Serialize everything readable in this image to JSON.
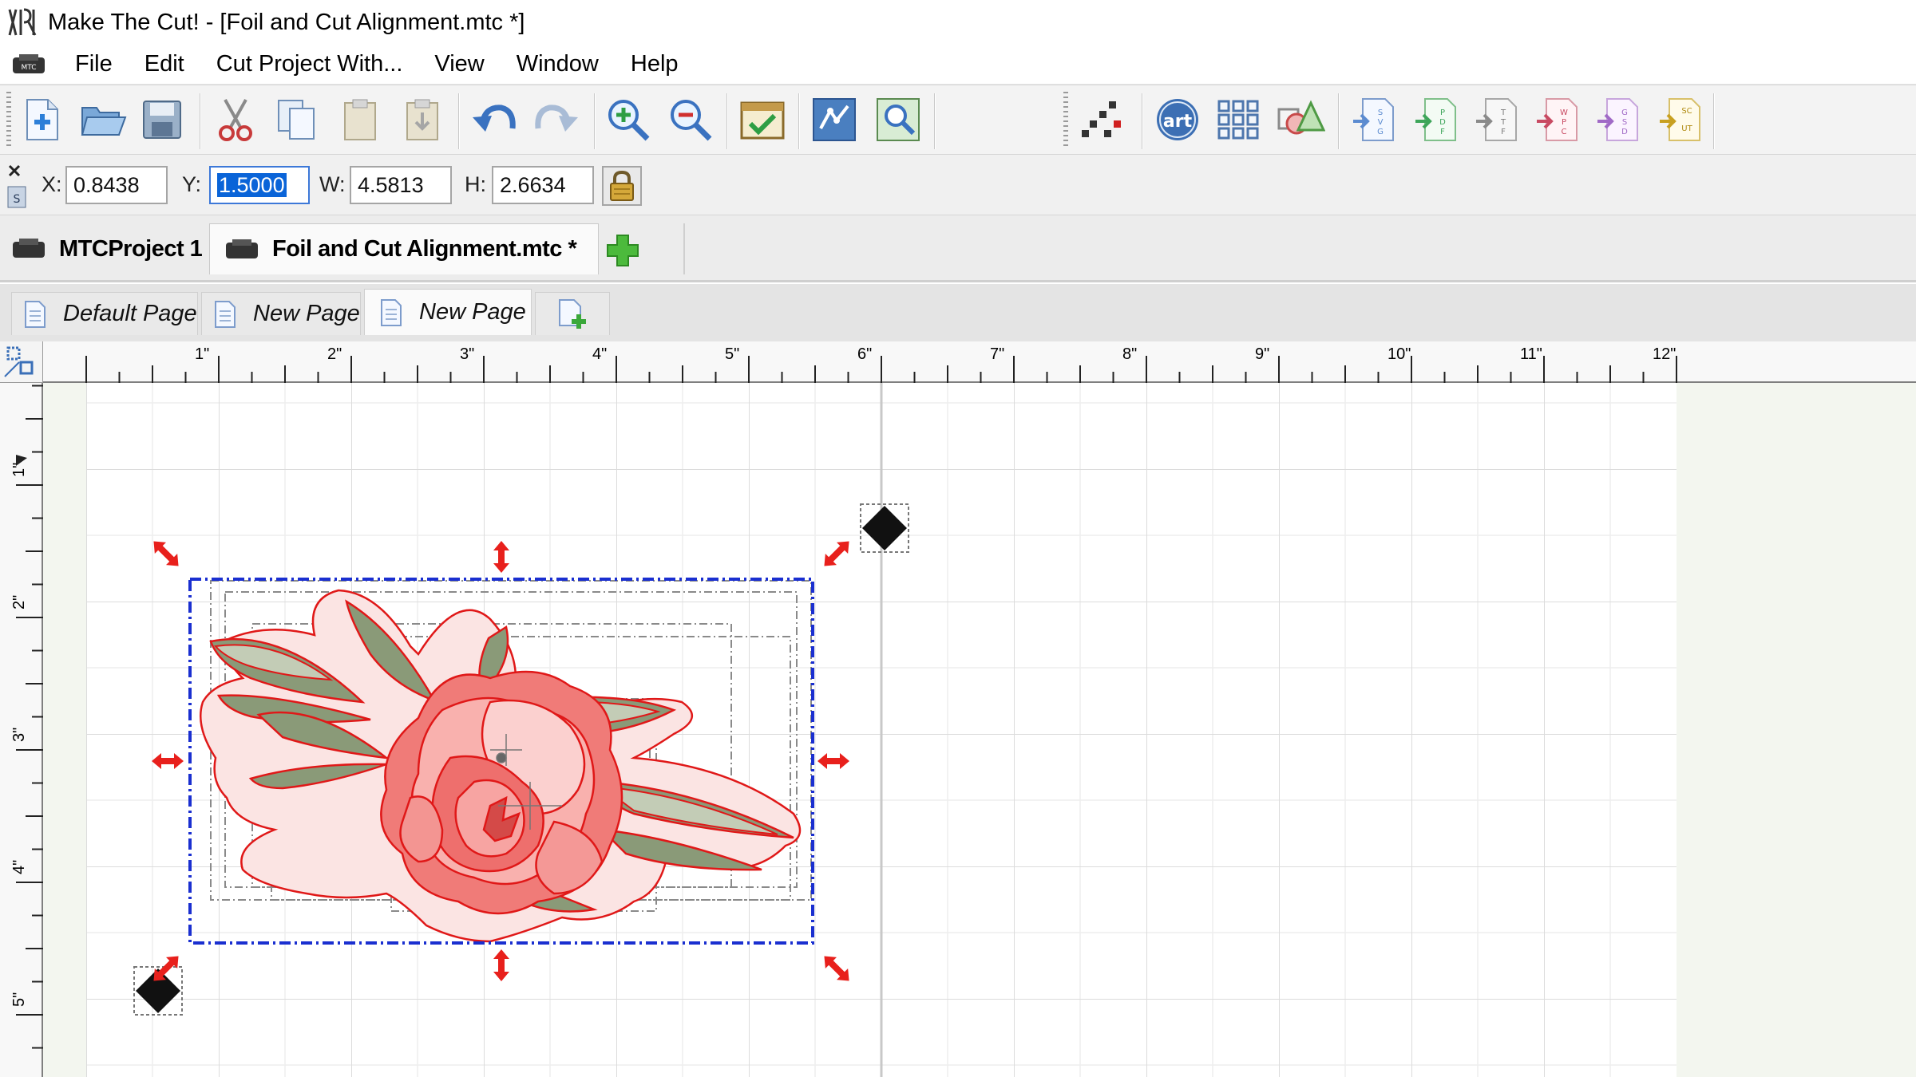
{
  "window": {
    "title": "Make The Cut! - [Foil and Cut Alignment.mtc *]"
  },
  "menu": {
    "items": [
      "File",
      "Edit",
      "Cut Project With...",
      "View",
      "Window",
      "Help"
    ]
  },
  "toolbar": {
    "left_buttons": [
      "new-file-icon",
      "open-folder-icon",
      "save-icon",
      "cut-icon",
      "copy-icon",
      "paste-icon",
      "paste-in-place-icon",
      "undo-icon",
      "redo-icon",
      "zoom-in-icon",
      "zoom-out-icon",
      "virtual-mat-icon",
      "trace-icon",
      "magic-zoom-icon"
    ],
    "right_buttons": [
      "node-edit-icon",
      "art-library-icon",
      "grid-array-icon",
      "shapes-icon",
      "import-svg-icon",
      "import-pdf-icon",
      "import-ttf-icon",
      "import-wpc-icon",
      "import-gsd-icon",
      "import-scut-icon"
    ]
  },
  "transform": {
    "x_label": "X:",
    "x_value": "0.8438",
    "y_label": "Y:",
    "y_value": "1.5000",
    "w_label": "W:",
    "w_value": "4.5813",
    "h_label": "H:",
    "h_value": "2.6634"
  },
  "project_tabs": [
    {
      "label": "MTCProject 1",
      "active": false
    },
    {
      "label": "Foil and Cut Alignment.mtc *",
      "active": true
    }
  ],
  "page_tabs": [
    {
      "label": "Default Page",
      "active": false
    },
    {
      "label": "New Page",
      "active": false
    },
    {
      "label": "New Page",
      "active": true
    }
  ],
  "rulers": {
    "horizontal": [
      "1\"",
      "2\"",
      "3\"",
      "4\"",
      "5\"",
      "6\"",
      "7\"",
      "8\"",
      "9\"",
      "10\"",
      "11\"",
      "12\""
    ],
    "vertical": [
      "1\"",
      "2\"",
      "3\"",
      "4\"",
      "5\""
    ]
  },
  "colors": {
    "selection": "#1a2fd0",
    "handles": "#e8201c",
    "flower_fill": "#f07b78",
    "flower_light": "#f9c2c0",
    "leaf_fill": "#8a9a78",
    "cut_line": "#e01818"
  }
}
